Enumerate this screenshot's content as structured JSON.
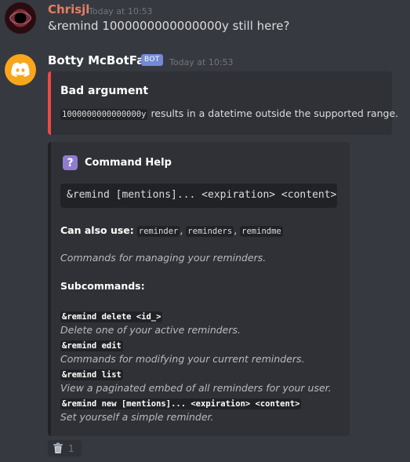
{
  "messages": [
    {
      "author": "Chrisjl",
      "timestamp": "Today at 10:53",
      "content": "&remind 1000000000000000y still here?"
    },
    {
      "author": "Botty McBotFace",
      "badge": "BOT",
      "timestamp": "Today at 10:53"
    }
  ],
  "error_embed": {
    "title": "Bad argument",
    "code": "1000000000000000y",
    "text": " results in a datetime outside the supported range.",
    "accent_color": "#f04747"
  },
  "help_embed": {
    "icon": "question-icon",
    "title": "Command Help",
    "usage": "&remind [mentions]... <expiration> <content>",
    "aliases_label": "Can also use:",
    "aliases": [
      "reminder",
      "reminders",
      "remindme"
    ],
    "description": "Commands for managing your reminders.",
    "subcommands_label": "Subcommands:",
    "subcommands": [
      {
        "command": "&remind delete <id_>",
        "description": "Delete one of your active reminders."
      },
      {
        "command": "&remind edit",
        "description": "Commands for modifying your current reminders."
      },
      {
        "command": "&remind list",
        "description": "View a paginated embed of all reminders for your user."
      },
      {
        "command": "&remind new [mentions]... <expiration> <content>",
        "description": "Set yourself a simple reminder."
      }
    ]
  },
  "reaction": {
    "icon": "wastebasket-icon",
    "count": "1"
  },
  "colors": {
    "background": "#36393f",
    "embed": "#2f3136",
    "bot_badge": "#7289da",
    "username1": "#e67e63",
    "discord_avatar": "#faa61a"
  }
}
